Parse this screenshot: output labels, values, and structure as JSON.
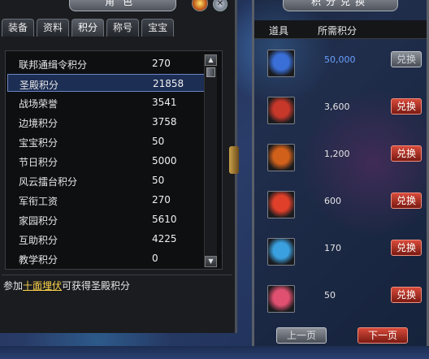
{
  "left_panel": {
    "title": "角色",
    "tabs": [
      "装备",
      "资料",
      "积分",
      "称号",
      "宝宝"
    ],
    "active_tab": 2,
    "rows": [
      {
        "name": "联邦通缉令积分",
        "value": "270"
      },
      {
        "name": "圣殿积分",
        "value": "21858"
      },
      {
        "name": "战场荣誉",
        "value": "3541"
      },
      {
        "name": "边境积分",
        "value": "3758"
      },
      {
        "name": "宝宝积分",
        "value": "50"
      },
      {
        "name": "节日积分",
        "value": "5000"
      },
      {
        "name": "风云擂台积分",
        "value": "50"
      },
      {
        "name": "军衔工资",
        "value": "270"
      },
      {
        "name": "家园积分",
        "value": "5610"
      },
      {
        "name": "互助积分",
        "value": "4225"
      },
      {
        "name": "教学积分",
        "value": "0"
      }
    ],
    "selected_row": 1,
    "description": {
      "prefix": "参加",
      "link": "十面埋伏",
      "suffix": "可获得圣殿积分"
    }
  },
  "right_panel": {
    "title": "积分兑换",
    "header": {
      "item": "道具",
      "cost": "所需积分"
    },
    "items": [
      {
        "cost": "50,000",
        "button": "兑换",
        "enabled": false,
        "icon": "blue-chest-icon",
        "color": "#3a6fd8"
      },
      {
        "cost": "3,600",
        "button": "兑换",
        "enabled": true,
        "icon": "red-chest-icon",
        "color": "#c8382a"
      },
      {
        "cost": "1,200",
        "button": "兑换",
        "enabled": true,
        "icon": "orange-chest-icon",
        "color": "#d0601a"
      },
      {
        "cost": "600",
        "button": "兑换",
        "enabled": true,
        "icon": "red-crystal-icon",
        "color": "#e0402a"
      },
      {
        "cost": "170",
        "button": "兑换",
        "enabled": true,
        "icon": "blue-crystal-icon",
        "color": "#3aa0e0"
      },
      {
        "cost": "50",
        "button": "兑换",
        "enabled": true,
        "icon": "pink-crystal-icon",
        "color": "#e05070"
      }
    ],
    "prev_label": "上一页",
    "next_label": "下一页"
  }
}
